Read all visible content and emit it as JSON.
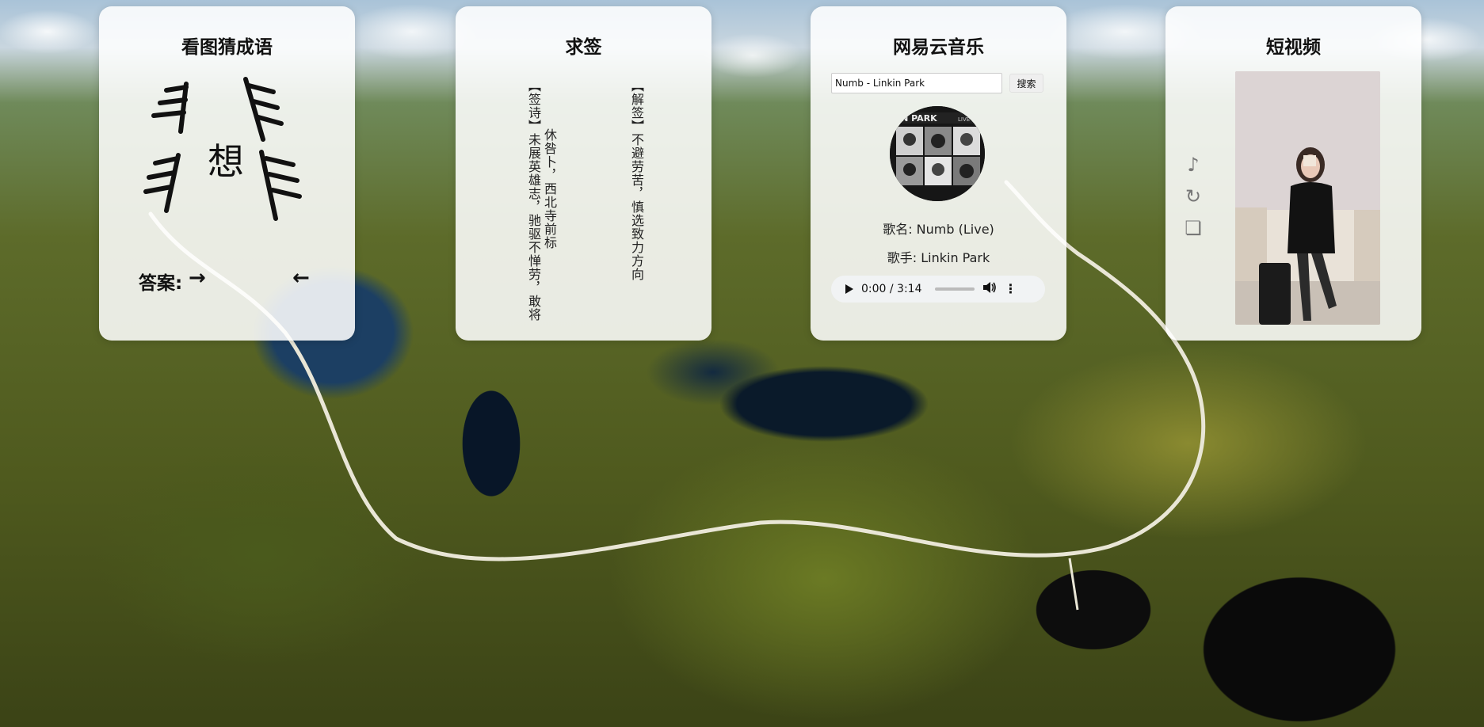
{
  "cards": {
    "idiom": {
      "title": "看图猜成语",
      "center_char": "想",
      "answer_label": "答案:",
      "arrow_right": "→",
      "arrow_left": "←"
    },
    "fortune": {
      "title": "求签",
      "poem_col1": "【签诗】未展英雄志，驰驱不惮劳，敢将",
      "poem_col2": "休咎卜，西北寺前标",
      "explain_col": "【解签】不避劳苦，慎选致力方向"
    },
    "music": {
      "title": "网易云音乐",
      "search_value": "Numb - Linkin Park",
      "search_button": "搜索",
      "album_text": "IN PARK",
      "album_live": "LIVE",
      "song_name": "歌名: Numb (Live)",
      "singer": "歌手: Linkin Park",
      "time": "0:00 / 3:14"
    },
    "video": {
      "title": "短视频",
      "icons": [
        "music-note-icon",
        "refresh-icon",
        "copy-icon"
      ],
      "icon_glyphs": [
        "♪",
        "↻",
        "❏"
      ]
    }
  }
}
